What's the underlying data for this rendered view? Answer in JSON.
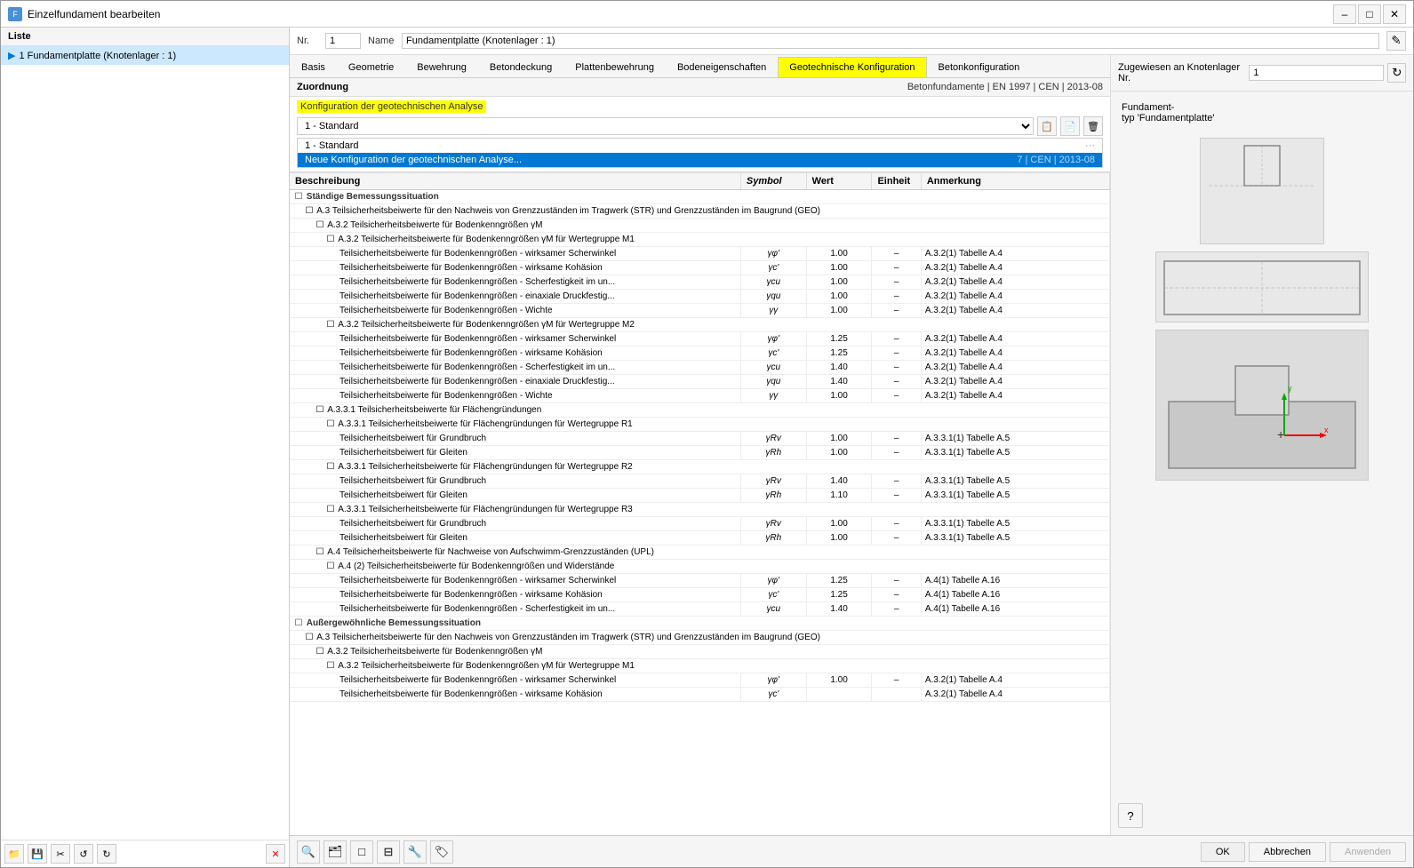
{
  "window": {
    "title": "Einzelfundament bearbeiten",
    "minimize_label": "–",
    "maximize_label": "□",
    "close_label": "✕"
  },
  "sidebar": {
    "header": "Liste",
    "items": [
      {
        "id": 1,
        "label": "1  Fundamentplatte (Knotenlager : 1)",
        "selected": true
      }
    ],
    "footer_buttons": [
      "📁",
      "💾",
      "✂",
      "↺",
      "↻"
    ],
    "delete_label": "✕"
  },
  "form_header": {
    "nr_label": "Nr.",
    "nr_value": "1",
    "name_label": "Name",
    "name_value": "Fundamentplatte (Knotenlager : 1)",
    "edit_icon": "✎"
  },
  "assigned_panel": {
    "label": "Zugewiesen an Knotenlager Nr.",
    "value": "1",
    "btn_icon": "↻"
  },
  "tabs": [
    {
      "id": "basis",
      "label": "Basis"
    },
    {
      "id": "geometrie",
      "label": "Geometrie"
    },
    {
      "id": "bewehrung",
      "label": "Bewehrung"
    },
    {
      "id": "betondeckung",
      "label": "Betondeckung"
    },
    {
      "id": "plattenbewehrung",
      "label": "Plattenbewehrung"
    },
    {
      "id": "bodeneigenschaften",
      "label": "Bodeneigenschaften"
    },
    {
      "id": "geotechnische_konfiguration",
      "label": "Geotechnische Konfiguration",
      "active": true,
      "highlighted": true
    },
    {
      "id": "betonkonfiguration",
      "label": "Betonkonfiguration"
    }
  ],
  "zuordnung": {
    "label": "Zuordnung",
    "norm_label": "Betonfundamente | EN 1997 | CEN | 2013-08"
  },
  "config": {
    "section_label": "Konfiguration der geotechnischen Analyse",
    "dropdown_value": "1 - Standard",
    "list_items": [
      {
        "label": "1 - Standard",
        "selected": false
      },
      {
        "label": "Neue Konfiguration der geotechnischen Analyse...",
        "selected": true
      }
    ],
    "norm_display": "7 | CEN | 2013-08",
    "btn_icons": [
      "📋",
      "📄",
      "🗑"
    ]
  },
  "table": {
    "columns": [
      "Beschreibung",
      "Symbol",
      "Wert",
      "Einheit",
      "Anmerkung"
    ],
    "sections": [
      {
        "type": "section",
        "label": "Ständige Bemessungssituation",
        "indent": 0,
        "children": [
          {
            "type": "group",
            "label": "A.3 Teilsicherheitsbeiwerte für den Nachweis von Grenzzuständen im Tragwerk (STR) und Grenzzuständen im Baugrund (GEO)",
            "indent": 1,
            "children": [
              {
                "type": "group",
                "label": "A.3.2 Teilsicherheitsbeiwerte für Bodenkenngrößen γM",
                "indent": 2,
                "children": [
                  {
                    "type": "group",
                    "label": "A.3.2 Teilsicherheitsbeiwerte für Bodenkenngrößen γM für Wertegruppe M1",
                    "indent": 3,
                    "children": [
                      {
                        "type": "row",
                        "label": "Teilsicherheitsbeiwerte für Bodenkenngrößen - wirksamer Scherwinkel",
                        "symbol": "γφ'",
                        "wert": "1.00",
                        "einheit": "–",
                        "anmerkung": "A.3.2(1) Tabelle A.4",
                        "indent": 4
                      },
                      {
                        "type": "row",
                        "label": "Teilsicherheitsbeiwerte für Bodenkenngrößen - wirksame Kohäsion",
                        "symbol": "γc'",
                        "wert": "1.00",
                        "einheit": "–",
                        "anmerkung": "A.3.2(1) Tabelle A.4",
                        "indent": 4
                      },
                      {
                        "type": "row",
                        "label": "Teilsicherheitsbeiwerte für Bodenkenngrößen - Scherfestigkeit im un...",
                        "symbol": "γcu",
                        "wert": "1.00",
                        "einheit": "–",
                        "anmerkung": "A.3.2(1) Tabelle A.4",
                        "indent": 4
                      },
                      {
                        "type": "row",
                        "label": "Teilsicherheitsbeiwerte für Bodenkenngrößen - einaxiale Druckfestig...",
                        "symbol": "γqu",
                        "wert": "1.00",
                        "einheit": "–",
                        "anmerkung": "A.3.2(1) Tabelle A.4",
                        "indent": 4
                      },
                      {
                        "type": "row",
                        "label": "Teilsicherheitsbeiwerte für Bodenkenngrößen - Wichte",
                        "symbol": "γγ",
                        "wert": "1.00",
                        "einheit": "–",
                        "anmerkung": "A.3.2(1) Tabelle A.4",
                        "indent": 4
                      }
                    ]
                  },
                  {
                    "type": "group",
                    "label": "A.3.2 Teilsicherheitsbeiwerte für Bodenkenngrößen γM für Wertegruppe M2",
                    "indent": 3,
                    "children": [
                      {
                        "type": "row",
                        "label": "Teilsicherheitsbeiwerte für Bodenkenngrößen - wirksamer Scherwinkel",
                        "symbol": "γφ'",
                        "wert": "1.25",
                        "einheit": "–",
                        "anmerkung": "A.3.2(1) Tabelle A.4",
                        "indent": 4
                      },
                      {
                        "type": "row",
                        "label": "Teilsicherheitsbeiwerte für Bodenkenngrößen - wirksame Kohäsion",
                        "symbol": "γc'",
                        "wert": "1.25",
                        "einheit": "–",
                        "anmerkung": "A.3.2(1) Tabelle A.4",
                        "indent": 4
                      },
                      {
                        "type": "row",
                        "label": "Teilsicherheitsbeiwerte für Bodenkenngrößen - Scherfestigkeit im un...",
                        "symbol": "γcu",
                        "wert": "1.40",
                        "einheit": "–",
                        "anmerkung": "A.3.2(1) Tabelle A.4",
                        "indent": 4
                      },
                      {
                        "type": "row",
                        "label": "Teilsicherheitsbeiwerte für Bodenkenngrößen - einaxiale Druckfestig...",
                        "symbol": "γqu",
                        "wert": "1.40",
                        "einheit": "–",
                        "anmerkung": "A.3.2(1) Tabelle A.4",
                        "indent": 4
                      },
                      {
                        "type": "row",
                        "label": "Teilsicherheitsbeiwerte für Bodenkenngrößen - Wichte",
                        "symbol": "γγ",
                        "wert": "1.00",
                        "einheit": "–",
                        "anmerkung": "A.3.2(1) Tabelle A.4",
                        "indent": 4
                      }
                    ]
                  }
                ]
              },
              {
                "type": "group",
                "label": "A.3.3.1 Teilsicherheitsbeiwerte für Flächengründungen",
                "indent": 2,
                "children": [
                  {
                    "type": "group",
                    "label": "A.3.3.1 Teilsicherheitsbeiwerte für Flächengründungen für Wertegruppe R1",
                    "indent": 3,
                    "children": [
                      {
                        "type": "row",
                        "label": "Teilsicherheitsbeiwert für Grundbruch",
                        "symbol": "γRv",
                        "wert": "1.00",
                        "einheit": "–",
                        "anmerkung": "A.3.3.1(1) Tabelle A.5",
                        "indent": 4
                      },
                      {
                        "type": "row",
                        "label": "Teilsicherheitsbeiwert für Gleiten",
                        "symbol": "γRh",
                        "wert": "1.00",
                        "einheit": "–",
                        "anmerkung": "A.3.3.1(1) Tabelle A.5",
                        "indent": 4
                      }
                    ]
                  },
                  {
                    "type": "group",
                    "label": "A.3.3.1 Teilsicherheitsbeiwerte für Flächengründungen für Wertegruppe R2",
                    "indent": 3,
                    "children": [
                      {
                        "type": "row",
                        "label": "Teilsicherheitsbeiwert für Grundbruch",
                        "symbol": "γRv",
                        "wert": "1.40",
                        "einheit": "–",
                        "anmerkung": "A.3.3.1(1) Tabelle A.5",
                        "indent": 4
                      },
                      {
                        "type": "row",
                        "label": "Teilsicherheitsbeiwert für Gleiten",
                        "symbol": "γRh",
                        "wert": "1.10",
                        "einheit": "–",
                        "anmerkung": "A.3.3.1(1) Tabelle A.5",
                        "indent": 4
                      }
                    ]
                  },
                  {
                    "type": "group",
                    "label": "A.3.3.1 Teilsicherheitsbeiwerte für Flächengründungen für Wertegruppe R3",
                    "indent": 3,
                    "children": [
                      {
                        "type": "row",
                        "label": "Teilsicherheitsbeiwert für Grundbruch",
                        "symbol": "γRv",
                        "wert": "1.00",
                        "einheit": "–",
                        "anmerkung": "A.3.3.1(1) Tabelle A.5",
                        "indent": 4
                      },
                      {
                        "type": "row",
                        "label": "Teilsicherheitsbeiwert für Gleiten",
                        "symbol": "γRh",
                        "wert": "1.00",
                        "einheit": "–",
                        "anmerkung": "A.3.3.1(1) Tabelle A.5",
                        "indent": 4
                      }
                    ]
                  }
                ]
              },
              {
                "type": "group",
                "label": "A.4 Teilsicherheitsbeiwerte für Nachweise von Aufschwimm-Grenzzuständen (UPL)",
                "indent": 2,
                "children": [
                  {
                    "type": "group",
                    "label": "A.4 (2) Teilsicherheitsbeiwerte für Bodenkenngrößen und Widerstände",
                    "indent": 3,
                    "children": [
                      {
                        "type": "row",
                        "label": "Teilsicherheitsbeiwerte für Bodenkenngrößen - wirksamer Scherwinkel",
                        "symbol": "γφ'",
                        "wert": "1.25",
                        "einheit": "–",
                        "anmerkung": "A.4(1) Tabelle A.16",
                        "indent": 4
                      },
                      {
                        "type": "row",
                        "label": "Teilsicherheitsbeiwerte für Bodenkenngrößen - wirksame Kohäsion",
                        "symbol": "γc'",
                        "wert": "1.25",
                        "einheit": "–",
                        "anmerkung": "A.4(1) Tabelle A.16",
                        "indent": 4
                      },
                      {
                        "type": "row",
                        "label": "Teilsicherheitsbeiwerte für Bodenkenngrößen - Scherfestigkeit im un...",
                        "symbol": "γcu",
                        "wert": "1.40",
                        "einheit": "–",
                        "anmerkung": "A.4(1) Tabelle A.16",
                        "indent": 4
                      }
                    ]
                  }
                ]
              }
            ]
          }
        ]
      },
      {
        "type": "section",
        "label": "Außergewöhnliche Bemessungssituation",
        "indent": 0,
        "children": [
          {
            "type": "group",
            "label": "A.3 Teilsicherheitsbeiwerte für den Nachweis von Grenzzuständen im Tragwerk (STR) und Grenzzuständen im Baugrund (GEO)",
            "indent": 1,
            "children": [
              {
                "type": "group",
                "label": "A.3.2 Teilsicherheitsbeiwerte für Bodenkenngrößen γM",
                "indent": 2,
                "children": [
                  {
                    "type": "group",
                    "label": "A.3.2 Teilsicherheitsbeiwerte für Bodenkenngrößen γM für Wertegruppe M1",
                    "indent": 3,
                    "children": [
                      {
                        "type": "row",
                        "label": "Teilsicherheitsbeiwerte für Bodenkenngrößen - wirksamer Scherwinkel",
                        "symbol": "γφ'",
                        "wert": "1.00",
                        "einheit": "–",
                        "anmerkung": "A.3.2(1) Tabelle A.4",
                        "indent": 4
                      },
                      {
                        "type": "row",
                        "label": "Teilsicherheitsbeiwerte für Bodenkenngrößen - wirksame Kohäsion",
                        "symbol": "γc'",
                        "wert": "",
                        "einheit": "",
                        "anmerkung": "A.3.2(1) Tabelle A.4",
                        "indent": 4
                      }
                    ]
                  }
                ]
              }
            ]
          }
        ]
      }
    ]
  },
  "right_panel": {
    "zugewiesen_label": "Zugewiesen an Knotenlager Nr.",
    "zugewiesen_value": "1",
    "fundamenttyp_label": "Fundament-\ntyp 'Fundamentplatte'"
  },
  "bottom_tools": [
    "🔍",
    "🗂",
    "□",
    "⊟",
    "🔧",
    "🏷"
  ],
  "buttons": {
    "ok": "OK",
    "abbrechen": "Abbrechen",
    "anwenden": "Anwenden"
  }
}
